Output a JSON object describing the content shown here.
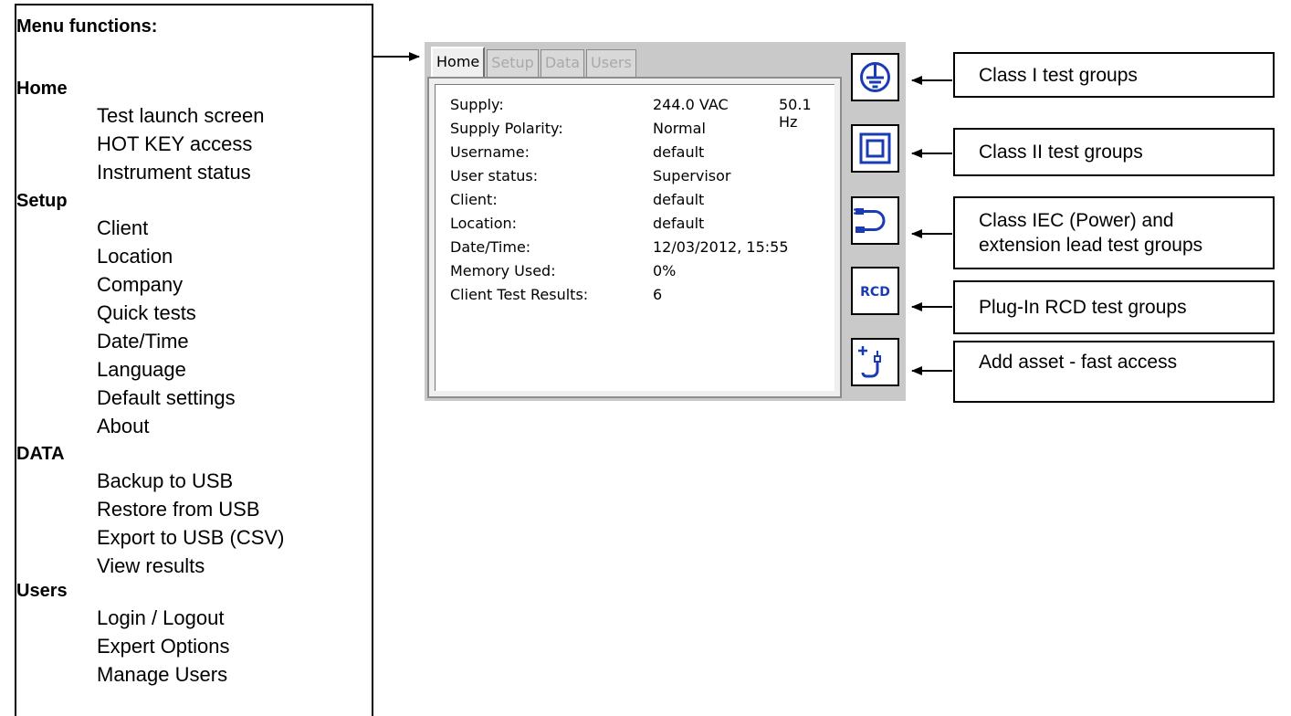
{
  "menu": {
    "title": "Menu functions:",
    "sections": [
      {
        "name": "Home",
        "items": [
          "Test launch screen",
          "HOT KEY access",
          "Instrument status"
        ]
      },
      {
        "name": "Setup",
        "items": [
          "Client",
          "Location",
          "Company",
          "Quick tests",
          "Date/Time",
          "Language",
          "Default settings",
          "About"
        ]
      },
      {
        "name": "DATA",
        "items": [
          "Backup to USB",
          "Restore from USB",
          "Export to USB (CSV)",
          "View results"
        ]
      },
      {
        "name": "Users",
        "items": [
          "Login / Logout",
          "Expert Options",
          "Manage Users"
        ]
      }
    ]
  },
  "screen": {
    "tabs": [
      "Home",
      "Setup",
      "Data",
      "Users"
    ],
    "rows": [
      {
        "label": "Supply:",
        "value": "244.0 VAC",
        "extra": "50.1 Hz"
      },
      {
        "label": "Supply Polarity:",
        "value": "Normal"
      },
      {
        "label": "Username:",
        "value": "default"
      },
      {
        "label": "User status:",
        "value": "Supervisor"
      },
      {
        "label": "Client:",
        "value": "default"
      },
      {
        "label": "Location:",
        "value": "default"
      },
      {
        "label": "Date/Time:",
        "value": "12/03/2012, 15:55"
      },
      {
        "label": "Memory Used:",
        "value": "0%"
      },
      {
        "label": "Client Test Results:",
        "value": "6"
      }
    ],
    "buttons": [
      {
        "icon": "earth-ground-icon"
      },
      {
        "icon": "double-insulation-icon"
      },
      {
        "icon": "power-lead-icon"
      },
      {
        "icon": "rcd-icon",
        "text": "RCD"
      },
      {
        "icon": "add-asset-icon"
      }
    ]
  },
  "callouts": [
    {
      "line1": "Class I test groups"
    },
    {
      "line1": "Class II test groups"
    },
    {
      "line1": "Class IEC (Power) and",
      "line2": "extension lead test groups"
    },
    {
      "line1": "Plug-In RCD test groups"
    },
    {
      "line1": "Add asset - fast access"
    }
  ],
  "colors": {
    "icon_blue": "#1a3bb4",
    "device_bg": "#c9c9c9",
    "panel_bg": "#efefef"
  }
}
